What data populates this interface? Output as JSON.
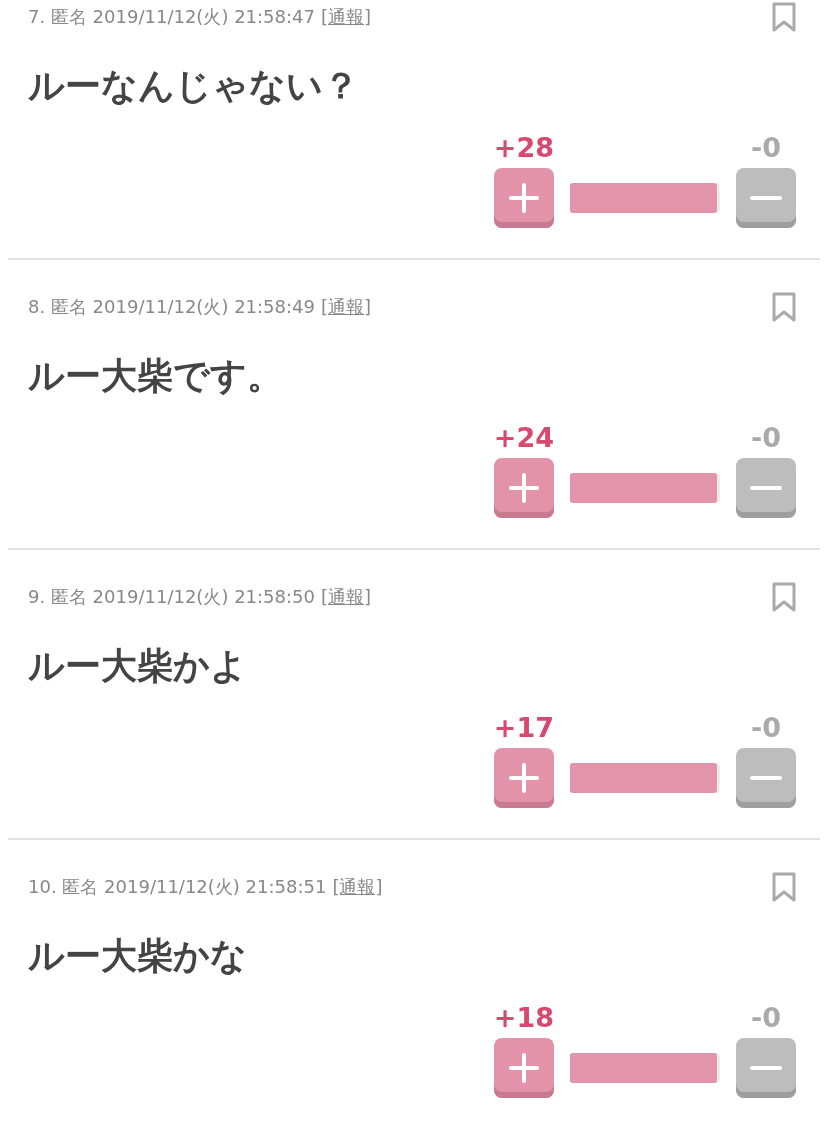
{
  "comments": [
    {
      "header": "7. 匿名 2019/11/12(火) 21:58:47",
      "report": "[通報]",
      "body": "ルーなんじゃない？",
      "plus": "+28",
      "minus": "-0",
      "level": 0.98
    },
    {
      "header": "8. 匿名 2019/11/12(火) 21:58:49",
      "report": "[通報]",
      "body": "ルー大柴です。",
      "plus": "+24",
      "minus": "-0",
      "level": 0.98
    },
    {
      "header": "9. 匿名 2019/11/12(火) 21:58:50",
      "report": "[通報]",
      "body": "ルー大柴かよ",
      "plus": "+17",
      "minus": "-0",
      "level": 0.98
    },
    {
      "header": "10. 匿名 2019/11/12(火) 21:58:51",
      "report": "[通報]",
      "body": "ルー大柴かな",
      "plus": "+18",
      "minus": "-0",
      "level": 0.98
    }
  ]
}
